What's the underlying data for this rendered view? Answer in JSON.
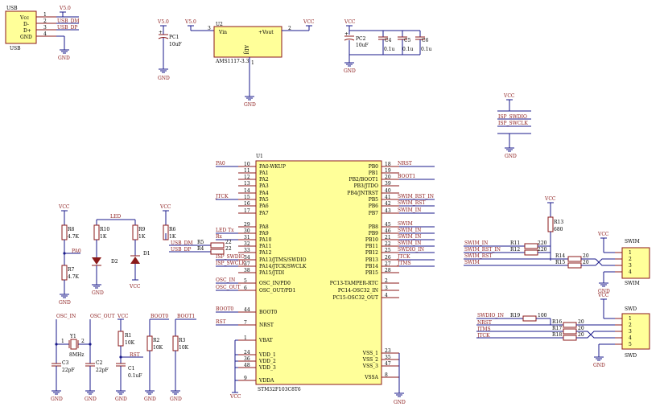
{
  "usb": {
    "label_top": "USB",
    "label_bottom": "USB",
    "pin_names": [
      "Vcc",
      "D-",
      "D+",
      "GND"
    ],
    "pin_numbers": [
      "1",
      "2",
      "3",
      "4"
    ],
    "nets": [
      "V5.0",
      "USB_DM",
      "USB_DP",
      "GND"
    ]
  },
  "pc1": {
    "net": "V5.0",
    "des": "PC1",
    "val": "10uF",
    "gnd": "GND"
  },
  "u2": {
    "net_in": "V5.0",
    "des": "U2",
    "vin": "Vin",
    "vout": "+Vout",
    "adj": "ADJ",
    "pin3": "3",
    "pin2": "2",
    "pin1": "1",
    "part": "AMS1117-3.3",
    "net_out": "VCC",
    "gnd": "GND"
  },
  "caps": {
    "net": "VCC",
    "gnd": "GND",
    "items": [
      {
        "des": "PC2",
        "val": "10uF"
      },
      {
        "des": "C4",
        "val": "0.1u"
      },
      {
        "des": "C5",
        "val": "0.1u"
      },
      {
        "des": "C6",
        "val": "0.1u"
      }
    ]
  },
  "isp": {
    "net": "VCC",
    "swdio": "ISP_SWDIO",
    "swclk": "ISP_SWCLK",
    "gnd": "GND"
  },
  "u1": {
    "des": "U1",
    "part": "STM32F103C8T6",
    "left": [
      {
        "net": "PA0",
        "num": "10",
        "name": "PA0-WKUP"
      },
      {
        "net": "",
        "num": "11",
        "name": "PA1"
      },
      {
        "net": "",
        "num": "12",
        "name": "PA2"
      },
      {
        "net": "",
        "num": "13",
        "name": "PA3"
      },
      {
        "net": "",
        "num": "14",
        "name": "PA4"
      },
      {
        "net": "JTCK",
        "num": "15",
        "name": "PA5"
      },
      {
        "net": "",
        "num": "16",
        "name": "PA6"
      },
      {
        "net": "",
        "num": "17",
        "name": "PA7"
      },
      {
        "net": "",
        "num": "29",
        "name": "PA8"
      },
      {
        "net": "LED Tx",
        "num": "30",
        "name": "PA9"
      },
      {
        "net": "Rx",
        "num": "31",
        "name": "PA10"
      },
      {
        "net": "",
        "num": "32",
        "name": "PA11"
      },
      {
        "net": "",
        "num": "33",
        "name": "PA12"
      },
      {
        "net": "ISP_SWDIO",
        "num": "34",
        "name": "PA13/JTMS/SWDIO"
      },
      {
        "net": "ISP_SWCLK",
        "num": "37",
        "name": "PA14/JTCK/SWCLK"
      },
      {
        "net": "",
        "num": "38",
        "name": "PA15/JTDI"
      },
      {
        "net": "OSC_IN",
        "num": "5",
        "name": "OSC_IN/PD0"
      },
      {
        "net": "OSC_OUT",
        "num": "6",
        "name": "OSC_OUT/PD1"
      },
      {
        "net": "BOOT0",
        "num": "44",
        "name": "BOOT0"
      },
      {
        "net": "RST",
        "num": "7",
        "name": "NRST"
      },
      {
        "net": "",
        "num": "1",
        "name": "VBAT"
      },
      {
        "net": "",
        "num": "24",
        "name": "VDD_1"
      },
      {
        "net": "",
        "num": "36",
        "name": "VDD_2"
      },
      {
        "net": "",
        "num": "48",
        "name": "VDD_3"
      },
      {
        "net": "",
        "num": "9",
        "name": "VDDA"
      }
    ],
    "right": [
      {
        "name": "PB0",
        "num": "18",
        "net": "NRST"
      },
      {
        "name": "PB1",
        "num": "19",
        "net": ""
      },
      {
        "name": "PB2/BOOT1",
        "num": "20",
        "net": "BOOT1"
      },
      {
        "name": "PB3/JTDO",
        "num": "39",
        "net": ""
      },
      {
        "name": "PB4/JNTRST",
        "num": "40",
        "net": ""
      },
      {
        "name": "PB5",
        "num": "41",
        "net": "SWIM_RST_IN"
      },
      {
        "name": "PB6",
        "num": "42",
        "net": "SWIM_RST"
      },
      {
        "name": "PB7",
        "num": "43",
        "net": "SWIM_IN"
      },
      {
        "name": "PB8",
        "num": "45",
        "net": "SWIM"
      },
      {
        "name": "PB9",
        "num": "46",
        "net": "SWIM_IN"
      },
      {
        "name": "PB10",
        "num": "21",
        "net": "SWIM_IN"
      },
      {
        "name": "PB11",
        "num": "22",
        "net": "SWIM_IN"
      },
      {
        "name": "PB12",
        "num": "25",
        "net": "SWDIO_IN"
      },
      {
        "name": "PB13",
        "num": "26",
        "net": "JTCK"
      },
      {
        "name": "PB14",
        "num": "27",
        "net": "JTMS"
      },
      {
        "name": "PB15",
        "num": "28",
        "net": ""
      },
      {
        "name": "PC13-TAMPER-RTC",
        "num": "2",
        "net": ""
      },
      {
        "name": "PC14-OSC32_IN",
        "num": "3",
        "net": ""
      },
      {
        "name": "PC15-OSC32_OUT",
        "num": "4",
        "net": ""
      },
      {
        "name": "VSS_1",
        "num": "23",
        "net": ""
      },
      {
        "name": "VSS_2",
        "num": "35",
        "net": ""
      },
      {
        "name": "VSS_3",
        "num": "47",
        "net": ""
      },
      {
        "name": "VSSA",
        "num": "8",
        "net": ""
      }
    ],
    "vcc": "VCC",
    "gnd": "GND"
  },
  "usb_res": {
    "r5": {
      "des": "R5",
      "val": "22",
      "net": "USB_DM"
    },
    "r4": {
      "des": "R4",
      "val": "22",
      "net": "USB_DP"
    }
  },
  "led": {
    "net_led": "LED",
    "vcc1": "VCC",
    "vcc2": "VCC",
    "r8": {
      "des": "R8",
      "val": "4.7K"
    },
    "r7": {
      "des": "R7",
      "val": "4.7K"
    },
    "r10": {
      "des": "R10",
      "val": "1K"
    },
    "r9": {
      "des": "R9",
      "val": "1K"
    },
    "r6": {
      "des": "R6",
      "val": "1K"
    },
    "d2": "D2",
    "d1": "D1",
    "pa0": "PA0",
    "vcc_bot": "VCC",
    "vcc_r6": "VCC"
  },
  "osc": {
    "in": "OSC_IN",
    "out": "OSC_OUT",
    "y1": "Y1",
    "freq": "8MHz",
    "p1": "1",
    "p2": "2",
    "c3": {
      "des": "C3",
      "val": "22pF"
    },
    "c2": {
      "des": "C2",
      "val": "22pF"
    }
  },
  "rst": {
    "vcc": "VCC",
    "net": "RST",
    "r1": {
      "des": "R1",
      "val": "10K"
    },
    "c1": {
      "des": "C1",
      "val": "0.1uF"
    }
  },
  "boot": {
    "boot0": "BOOT0",
    "boot1": "BOOT1",
    "r2": {
      "des": "R2",
      "val": "10K"
    },
    "r3": {
      "des": "R3",
      "val": "10K"
    }
  },
  "swim": {
    "vcc": "VCC",
    "r13": {
      "des": "R13",
      "val": "680"
    },
    "in1": "SWIM_IN",
    "in2": "SWIM_RST_IN",
    "rst": "SWIM_RST",
    "swim": "SWIM",
    "r11": {
      "des": "R11",
      "val": "220"
    },
    "r12": {
      "des": "R12",
      "val": "220"
    },
    "r14": {
      "des": "R14",
      "val": "20"
    },
    "r15": {
      "des": "R15",
      "val": "20"
    },
    "title": "SWIM",
    "pins": [
      "1",
      "2",
      "3",
      "4"
    ],
    "gnd": "GND",
    "vcc2": "VCC"
  },
  "swd": {
    "vcc": "VCC",
    "title": "SWD",
    "pins": [
      "1",
      "2",
      "3",
      "4",
      "5"
    ],
    "gnd": "GND",
    "nets": [
      "SWDIO_IN",
      "NRST",
      "JTMS",
      "JTCK"
    ],
    "r19": {
      "des": "R19",
      "val": "100"
    },
    "r16": {
      "des": "R16",
      "val": "20"
    },
    "r17": {
      "des": "R17",
      "val": "20"
    },
    "r18": {
      "des": "R18",
      "val": "20"
    }
  }
}
